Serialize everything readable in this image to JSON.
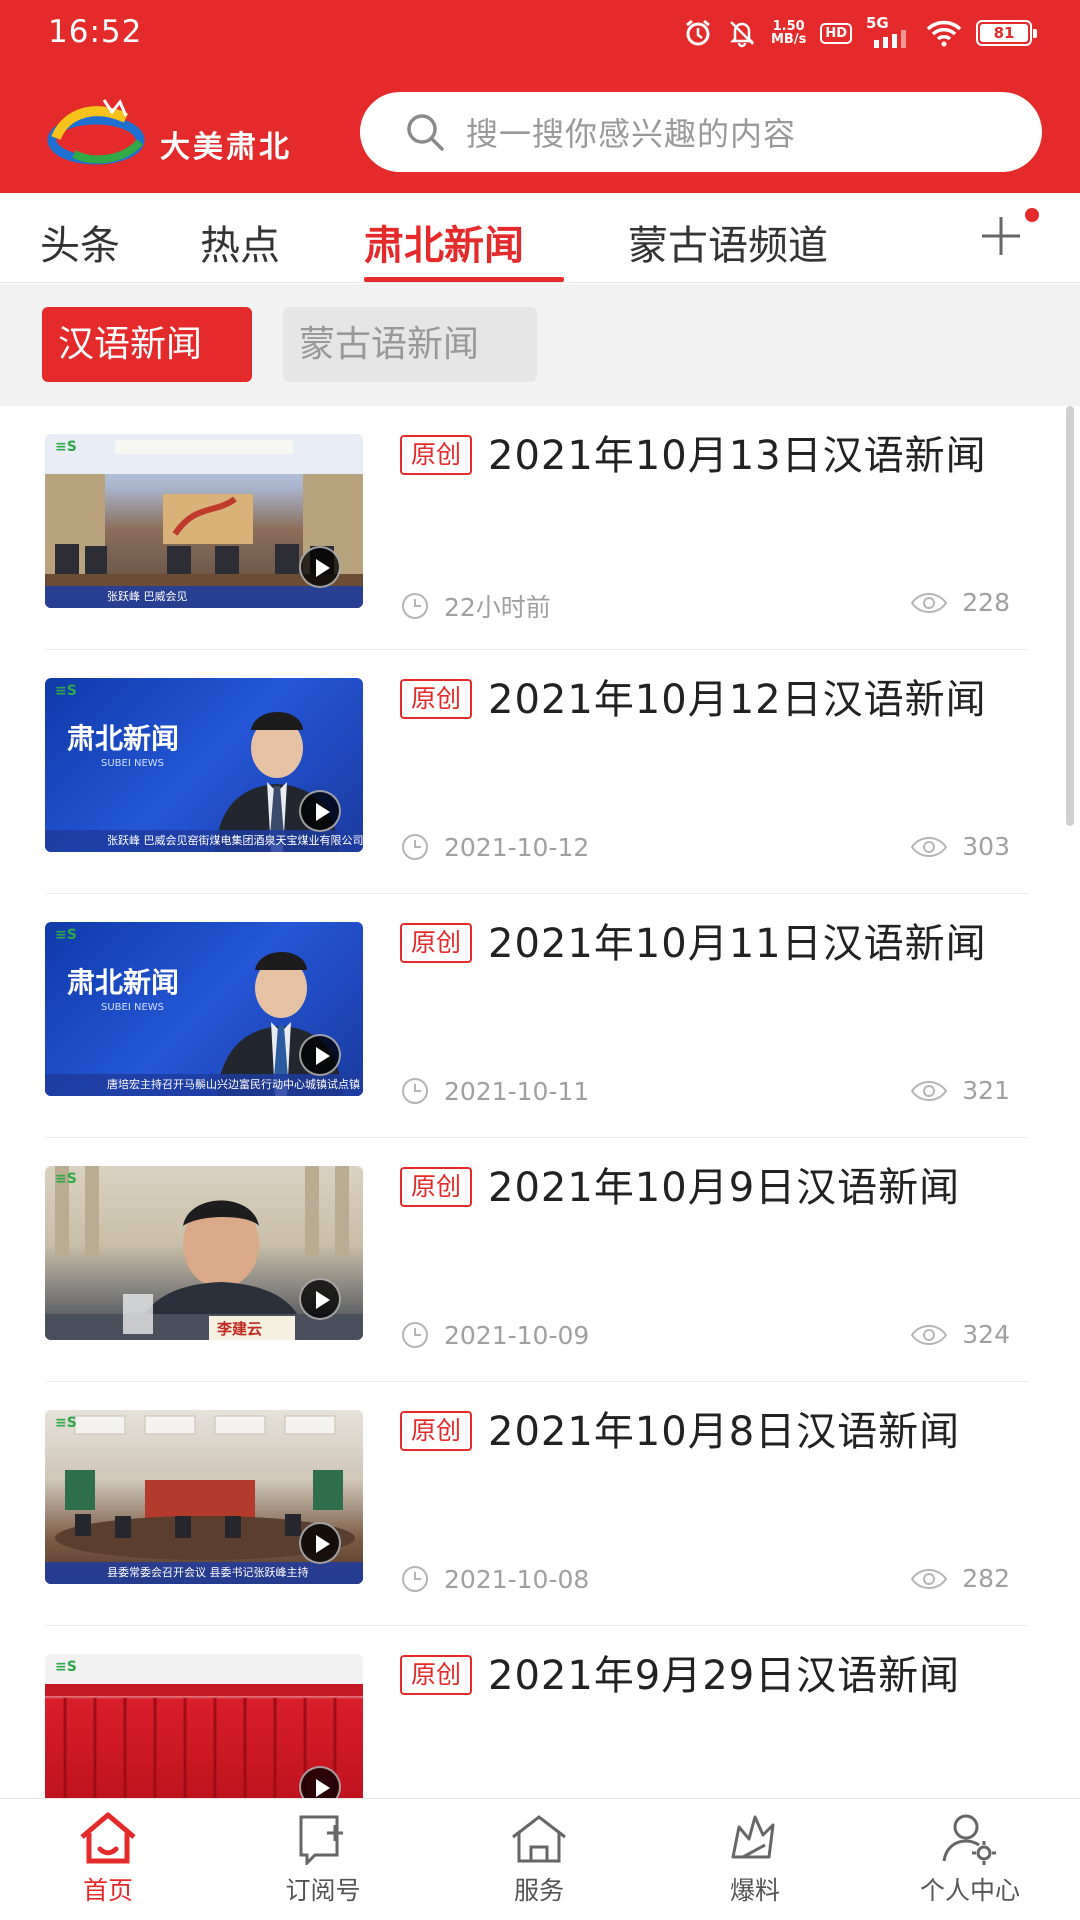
{
  "status_bar": {
    "time": "16:52",
    "net_speed_value": "1.50",
    "net_speed_unit": "MB/s",
    "hd_label": "HD",
    "network_label": "5G",
    "battery_level": "81"
  },
  "header": {
    "logo_text": "大美肃北",
    "search_placeholder": "搜一搜你感兴趣的内容"
  },
  "top_tabs": [
    {
      "label": "头条"
    },
    {
      "label": "热点"
    },
    {
      "label": "肃北新闻",
      "active": true
    },
    {
      "label": "蒙古语频道"
    }
  ],
  "sub_tabs": [
    {
      "label": "汉语新闻",
      "active": true
    },
    {
      "label": "蒙古语新闻"
    }
  ],
  "news": [
    {
      "badge": "原创",
      "title": "2021年10月13日汉语新闻",
      "time": "22小时前",
      "views": "228",
      "caption": "张跃峰 巴威会见"
    },
    {
      "badge": "原创",
      "title": "2021年10月12日汉语新闻",
      "time": "2021-10-12",
      "views": "303",
      "caption": "张跃峰 巴威会见窑街煤电集团酒泉天宝煤业有限公司董事长一行"
    },
    {
      "badge": "原创",
      "title": "2021年10月11日汉语新闻",
      "time": "2021-10-11",
      "views": "321",
      "caption": "唐培宏主持召开马鬃山兴边富民行动中心城镇试点镇"
    },
    {
      "badge": "原创",
      "title": "2021年10月9日汉语新闻",
      "time": "2021-10-09",
      "views": "324",
      "caption": "李建云"
    },
    {
      "badge": "原创",
      "title": "2021年10月8日汉语新闻",
      "time": "2021-10-08",
      "views": "282",
      "caption": "县委常委会召开会议 县委书记张跃峰主持"
    },
    {
      "badge": "原创",
      "title": "2021年9月29日汉语新闻",
      "time": "",
      "views": "",
      "caption": ""
    }
  ],
  "bottom_nav": [
    {
      "label": "首页",
      "icon": "home-icon",
      "active": true
    },
    {
      "label": "订阅号",
      "icon": "subscribe-icon"
    },
    {
      "label": "服务",
      "icon": "service-icon"
    },
    {
      "label": "爆料",
      "icon": "tipoff-icon"
    },
    {
      "label": "个人中心",
      "icon": "user-center-icon"
    }
  ],
  "colors": {
    "brand_red": "#e42a2a",
    "text_dark": "#222222",
    "text_gray": "#a0a0a0"
  }
}
